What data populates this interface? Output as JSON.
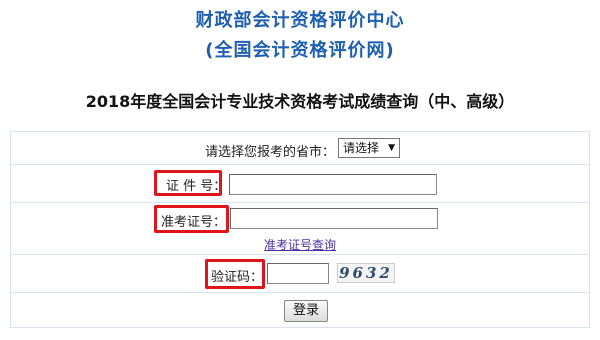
{
  "header": {
    "org_name": "财政部会计资格评价中心",
    "org_site": "(全国会计资格评价网)",
    "query_title": "2018年度全国会计专业技术资格考试成绩查询（中、高级）"
  },
  "form": {
    "province_label": "请选择您报考的省市：",
    "province_selected": "请选择",
    "id_label": "证 件 号：",
    "id_value": "",
    "admission_label": "准考证号：",
    "admission_value": "",
    "admission_lookup_link": "准考证号查询",
    "captcha_label": "验证码：",
    "captcha_value": "",
    "captcha_image_text": "9632",
    "login_button": "登录"
  },
  "colors": {
    "title_blue": "#1f5fb0",
    "highlight_red": "#e0141b",
    "border_light_blue": "#d6e4f2",
    "link_purple": "#4a2fa0"
  }
}
